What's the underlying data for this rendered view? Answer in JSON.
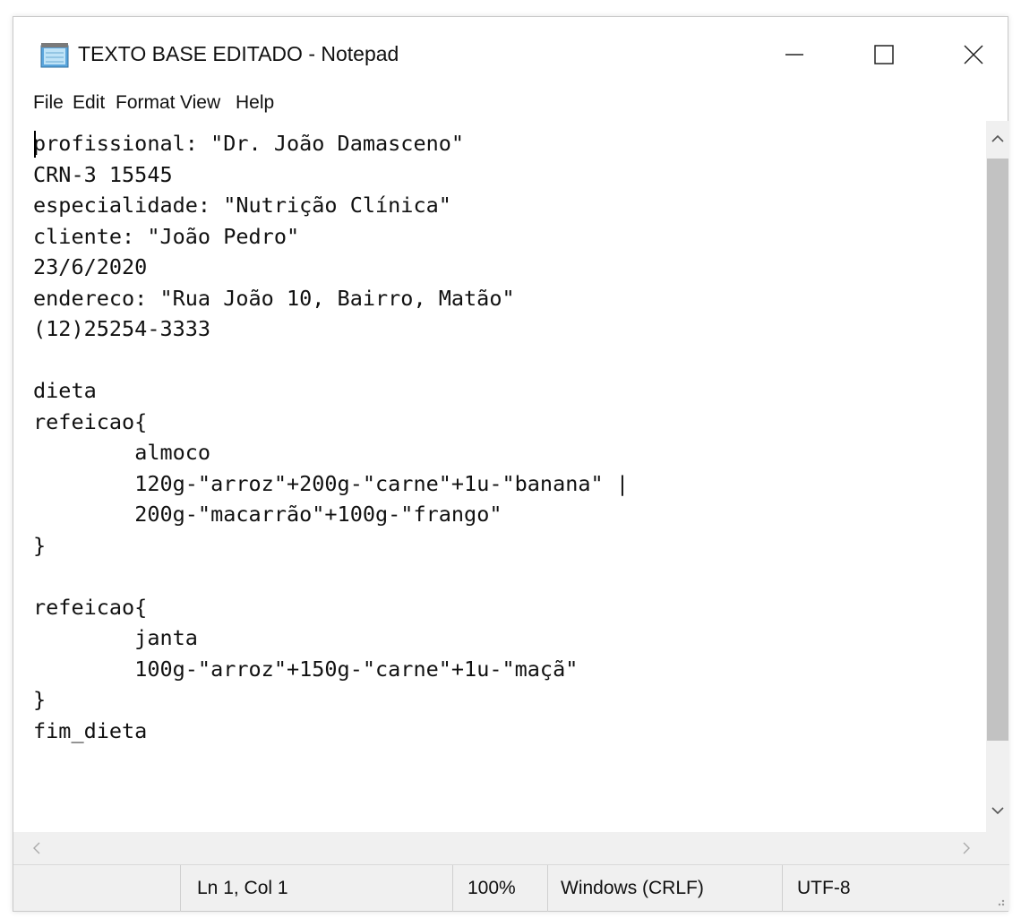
{
  "window": {
    "title": "TEXTO BASE EDITADO - Notepad",
    "icon": "notepad-icon"
  },
  "controls": {
    "minimize": "—",
    "maximize_icon": "maximize-icon",
    "close_icon": "close-icon"
  },
  "menu": {
    "items": [
      "File",
      "Edit",
      "Format",
      "View",
      "Help"
    ]
  },
  "editor": {
    "content": "profissional: \"Dr. João Damasceno\"\nCRN-3 15545\nespecialidade: \"Nutrição Clínica\"\ncliente: \"João Pedro\"\n23/6/2020\nendereco: \"Rua João 10, Bairro, Matão\"\n(12)25254-3333\n\ndieta\nrefeicao{\n\t\talmoco\n\t\t120g-\"arroz\"+200g-\"carne\"+1u-\"banana\" |\n\t\t200g-\"macarrão\"+100g-\"frango\"\n}\n\nrefeicao{\n\t\tjanta\n\t\t100g-\"arroz\"+150g-\"carne\"+1u-\"maçã\"\n}\nfim_dieta"
  },
  "status": {
    "position": "Ln 1, Col 1",
    "zoom": "100%",
    "line_ending": "Windows (CRLF)",
    "encoding": "UTF-8"
  }
}
